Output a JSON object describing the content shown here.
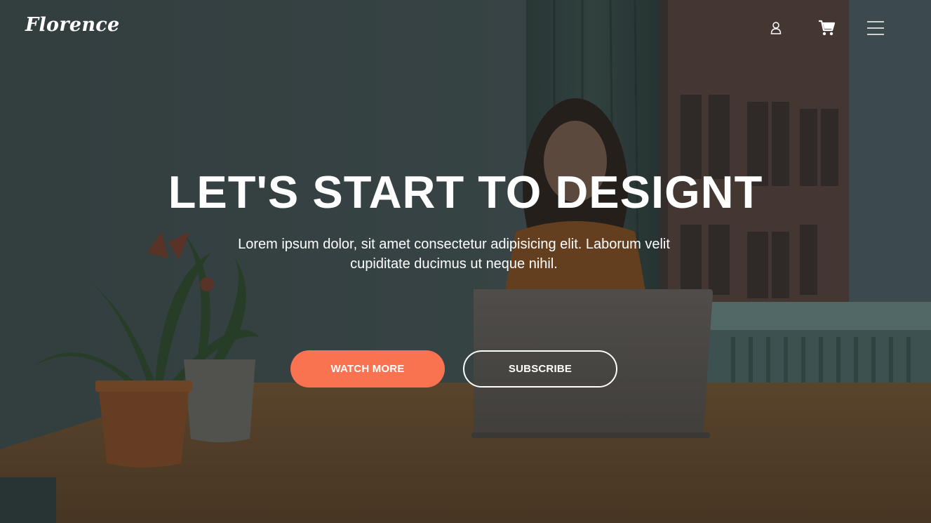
{
  "brand": {
    "name": "Florence"
  },
  "nav": {
    "icons": [
      "user-icon",
      "cart-icon",
      "hamburger-menu-icon"
    ]
  },
  "hero": {
    "headline": "LET'S START TO DESIGNT",
    "subtext": "Lorem ipsum dolor, sit amet consectetur adipisicing elit. Laborum velit cupiditate ducimus ut neque nihil.",
    "primary_button": "WATCH MORE",
    "secondary_button": "SUBSCRIBE"
  },
  "colors": {
    "accent": "#fa7350",
    "text": "#ffffff",
    "overlay": "#1c2424"
  }
}
